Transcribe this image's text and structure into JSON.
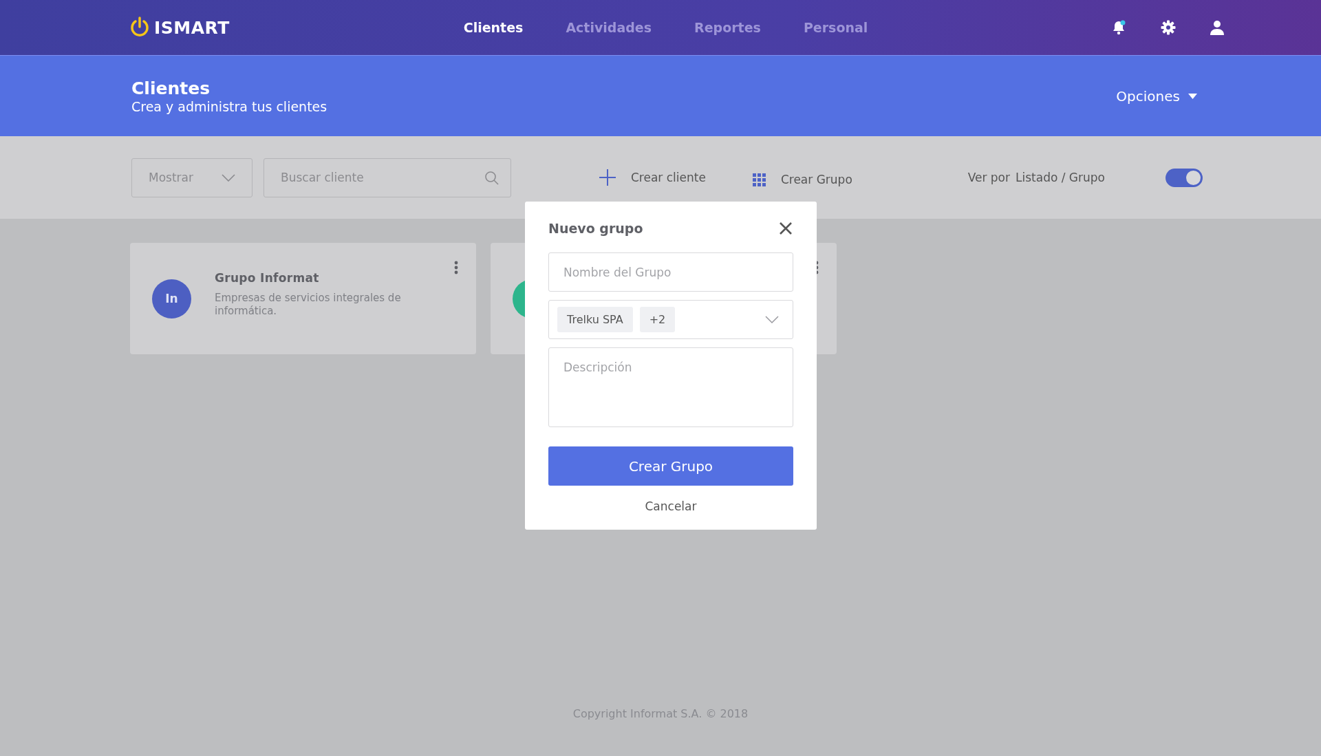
{
  "nav": {
    "brand": "ISMART",
    "items": [
      {
        "label": "Clientes",
        "selected": true
      },
      {
        "label": "Actividades",
        "selected": false
      },
      {
        "label": "Reportes",
        "selected": false
      },
      {
        "label": "Personal",
        "selected": false
      }
    ],
    "notification_unread": true
  },
  "header": {
    "title": "Clientes",
    "subtitle": "Crea y administra tus clientes",
    "options": "Opciones"
  },
  "toolbar": {
    "filter": "Mostrar",
    "search": {
      "placeholder": "Buscar cliente"
    },
    "create_client": "Crear cliente",
    "create_group": "Crear Grupo",
    "view_label": "Ver por",
    "view_options": "Listado / Grupo",
    "view_toggle": {
      "on": true
    }
  },
  "cards": [
    {
      "initials": "In",
      "title": "Grupo Informat",
      "description": "Empresas de servicios integrales de informática.",
      "color": "#4d5fc2"
    },
    {
      "color": "#2db58c"
    }
  ],
  "modal": {
    "title": "Nuevo grupo",
    "name_field": {
      "placeholder": "Nombre del Grupo"
    },
    "members": [
      "Trelku SPA",
      "+2"
    ],
    "description_field": {
      "placeholder": "Descripción"
    },
    "submit": "Crear Grupo",
    "cancel": "Cancelar"
  },
  "footer": "Copyright Informat S.A. © 2018"
}
